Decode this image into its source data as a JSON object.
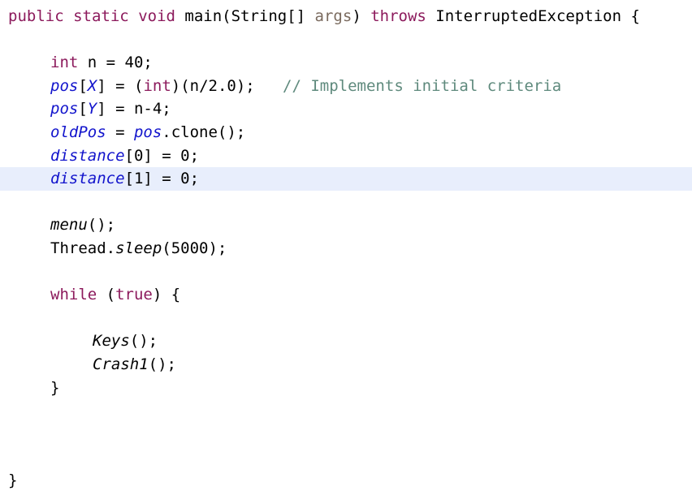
{
  "editor": {
    "language": "java",
    "colors": {
      "background": "#ffffff",
      "foreground": "#000000",
      "keyword": "#8c1a5c",
      "field": "#1214cc",
      "method": "#000000",
      "parameter": "#7a6a5e",
      "comment": "#5f8a7d",
      "current_line_highlight": "#e8eefc"
    },
    "current_line_index": 6,
    "lines": [
      {
        "index": 0,
        "indent": 0,
        "highlight": false,
        "tokens": [
          {
            "text": "public",
            "type": "keyword"
          },
          {
            "text": " ",
            "type": "plain"
          },
          {
            "text": "static",
            "type": "keyword"
          },
          {
            "text": " ",
            "type": "plain"
          },
          {
            "text": "void",
            "type": "keyword"
          },
          {
            "text": " main(String[] ",
            "type": "plain"
          },
          {
            "text": "args",
            "type": "parameter"
          },
          {
            "text": ") ",
            "type": "plain"
          },
          {
            "text": "throws",
            "type": "keyword"
          },
          {
            "text": " InterruptedException {",
            "type": "plain"
          }
        ]
      },
      {
        "index": 1,
        "indent": 0,
        "highlight": false,
        "tokens": []
      },
      {
        "index": 2,
        "indent": 1,
        "highlight": false,
        "tokens": [
          {
            "text": "int",
            "type": "keyword"
          },
          {
            "text": " n = 40;",
            "type": "plain"
          }
        ]
      },
      {
        "index": 3,
        "indent": 1,
        "highlight": false,
        "tokens": [
          {
            "text": "pos",
            "type": "field"
          },
          {
            "text": "[",
            "type": "plain"
          },
          {
            "text": "X",
            "type": "field"
          },
          {
            "text": "] = (",
            "type": "plain"
          },
          {
            "text": "int",
            "type": "keyword"
          },
          {
            "text": ")(n/2.0);",
            "type": "plain"
          },
          {
            "text": "   ",
            "type": "plain"
          },
          {
            "text": "// Implements initial criteria",
            "type": "comment"
          }
        ]
      },
      {
        "index": 4,
        "indent": 1,
        "highlight": false,
        "tokens": [
          {
            "text": "pos",
            "type": "field"
          },
          {
            "text": "[",
            "type": "plain"
          },
          {
            "text": "Y",
            "type": "field"
          },
          {
            "text": "] = n-4;",
            "type": "plain"
          }
        ]
      },
      {
        "index": 5,
        "indent": 1,
        "highlight": false,
        "tokens": [
          {
            "text": "oldPos",
            "type": "field"
          },
          {
            "text": " = ",
            "type": "plain"
          },
          {
            "text": "pos",
            "type": "field"
          },
          {
            "text": ".clone();",
            "type": "plain"
          }
        ]
      },
      {
        "index": 6,
        "indent": 1,
        "highlight": false,
        "tokens": [
          {
            "text": "distance",
            "type": "field"
          },
          {
            "text": "[0] = 0;",
            "type": "plain"
          }
        ]
      },
      {
        "index": 7,
        "indent": 1,
        "highlight": true,
        "tokens": [
          {
            "text": "distance",
            "type": "field"
          },
          {
            "text": "[1] = 0;",
            "type": "plain"
          }
        ]
      },
      {
        "index": 8,
        "indent": 0,
        "highlight": false,
        "tokens": []
      },
      {
        "index": 9,
        "indent": 1,
        "highlight": false,
        "tokens": [
          {
            "text": "menu",
            "type": "method"
          },
          {
            "text": "();",
            "type": "plain"
          }
        ]
      },
      {
        "index": 10,
        "indent": 1,
        "highlight": false,
        "tokens": [
          {
            "text": "Thread.",
            "type": "plain"
          },
          {
            "text": "sleep",
            "type": "method"
          },
          {
            "text": "(5000);",
            "type": "plain"
          }
        ]
      },
      {
        "index": 11,
        "indent": 0,
        "highlight": false,
        "tokens": []
      },
      {
        "index": 12,
        "indent": 1,
        "highlight": false,
        "tokens": [
          {
            "text": "while",
            "type": "keyword"
          },
          {
            "text": " (",
            "type": "plain"
          },
          {
            "text": "true",
            "type": "keyword"
          },
          {
            "text": ") {",
            "type": "plain"
          }
        ]
      },
      {
        "index": 13,
        "indent": 0,
        "highlight": false,
        "tokens": []
      },
      {
        "index": 14,
        "indent": 2,
        "highlight": false,
        "tokens": [
          {
            "text": "Keys",
            "type": "method"
          },
          {
            "text": "();",
            "type": "plain"
          }
        ]
      },
      {
        "index": 15,
        "indent": 2,
        "highlight": false,
        "tokens": [
          {
            "text": "Crash1",
            "type": "method"
          },
          {
            "text": "();",
            "type": "plain"
          }
        ]
      },
      {
        "index": 16,
        "indent": 1,
        "highlight": false,
        "tokens": [
          {
            "text": "}",
            "type": "plain"
          }
        ]
      },
      {
        "index": 17,
        "indent": 0,
        "highlight": false,
        "tokens": []
      },
      {
        "index": 18,
        "indent": 0,
        "highlight": false,
        "tokens": []
      },
      {
        "index": 19,
        "indent": 0,
        "highlight": false,
        "tokens": []
      },
      {
        "index": 20,
        "indent": 0,
        "highlight": false,
        "tokens": [
          {
            "text": "}",
            "type": "plain"
          }
        ]
      }
    ]
  }
}
